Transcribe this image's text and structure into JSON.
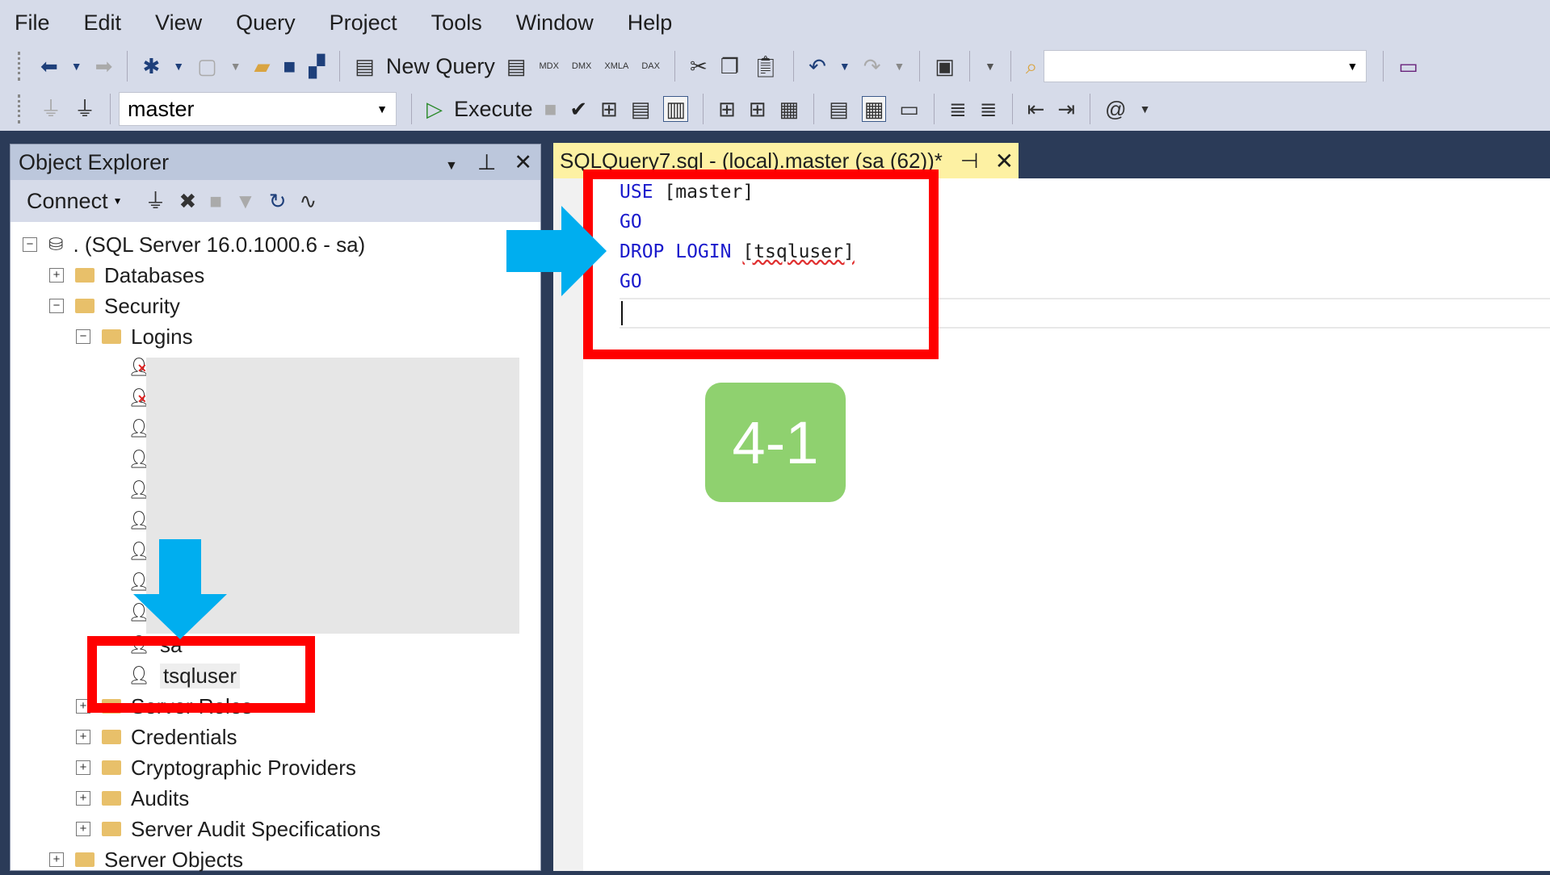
{
  "menu": [
    "File",
    "Edit",
    "View",
    "Query",
    "Project",
    "Tools",
    "Window",
    "Help"
  ],
  "toolbar": {
    "new_query": "New Query",
    "mdx": "MDX",
    "dmx": "DMX",
    "xmla": "XMLA",
    "dax": "DAX",
    "database": "master",
    "execute": "Execute"
  },
  "object_explorer": {
    "title": "Object Explorer",
    "connect": "Connect",
    "tree": {
      "root": ". (SQL Server 16.0.1000.6 - sa)",
      "databases": "Databases",
      "security": "Security",
      "logins": "Logins",
      "login_sa": "sa",
      "login_tsqluser": "tsqluser",
      "server_roles": "Server Roles",
      "credentials": "Credentials",
      "crypto": "Cryptographic Providers",
      "audits": "Audits",
      "audit_specs": "Server Audit Specifications",
      "server_objects": "Server Objects"
    }
  },
  "editor": {
    "tab_title": "SQLQuery7.sql - (local).master (sa (62))*",
    "lines": [
      {
        "kw": "USE",
        "rest": "[master]"
      },
      {
        "kw": "GO"
      },
      {
        "kw": "DROP LOGIN",
        "rest": "[tsqluser]"
      },
      {
        "kw": "GO"
      }
    ]
  },
  "annotation": {
    "step_label": "4-1",
    "highlight_color": "#ff0000",
    "arrow_color": "#00aeef",
    "badge_color": "#8fd16f"
  }
}
